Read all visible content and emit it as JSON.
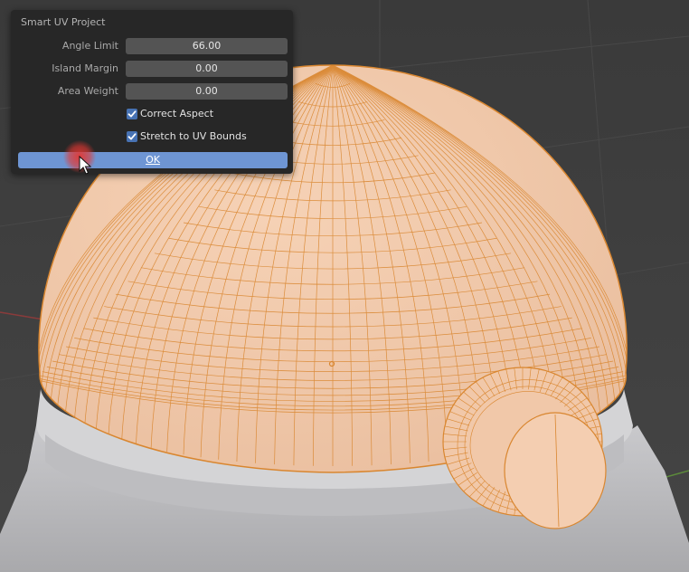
{
  "dialog": {
    "title": "Smart UV Project",
    "fields": [
      {
        "label": "Angle Limit",
        "value": "66.00"
      },
      {
        "label": "Island Margin",
        "value": "0.00"
      },
      {
        "label": "Area Weight",
        "value": "0.00"
      }
    ],
    "checkboxes": [
      {
        "label": "Correct Aspect",
        "checked": true
      },
      {
        "label": "Stretch to UV Bounds",
        "checked": true
      }
    ],
    "ok_label": "OK"
  },
  "icons": {
    "cursor": "mouse-pointer-icon",
    "checkmark": "checkmark-icon"
  },
  "colors": {
    "viewport_background": "#3d3d3d",
    "popup_background": "#272727",
    "field_background": "#545454",
    "accent": "#4772b3",
    "ok_button": "#6e95d3",
    "mesh_fill": "#f2c9aa",
    "mesh_wire": "#d9862f",
    "base_gray": "#b8b8bb"
  }
}
